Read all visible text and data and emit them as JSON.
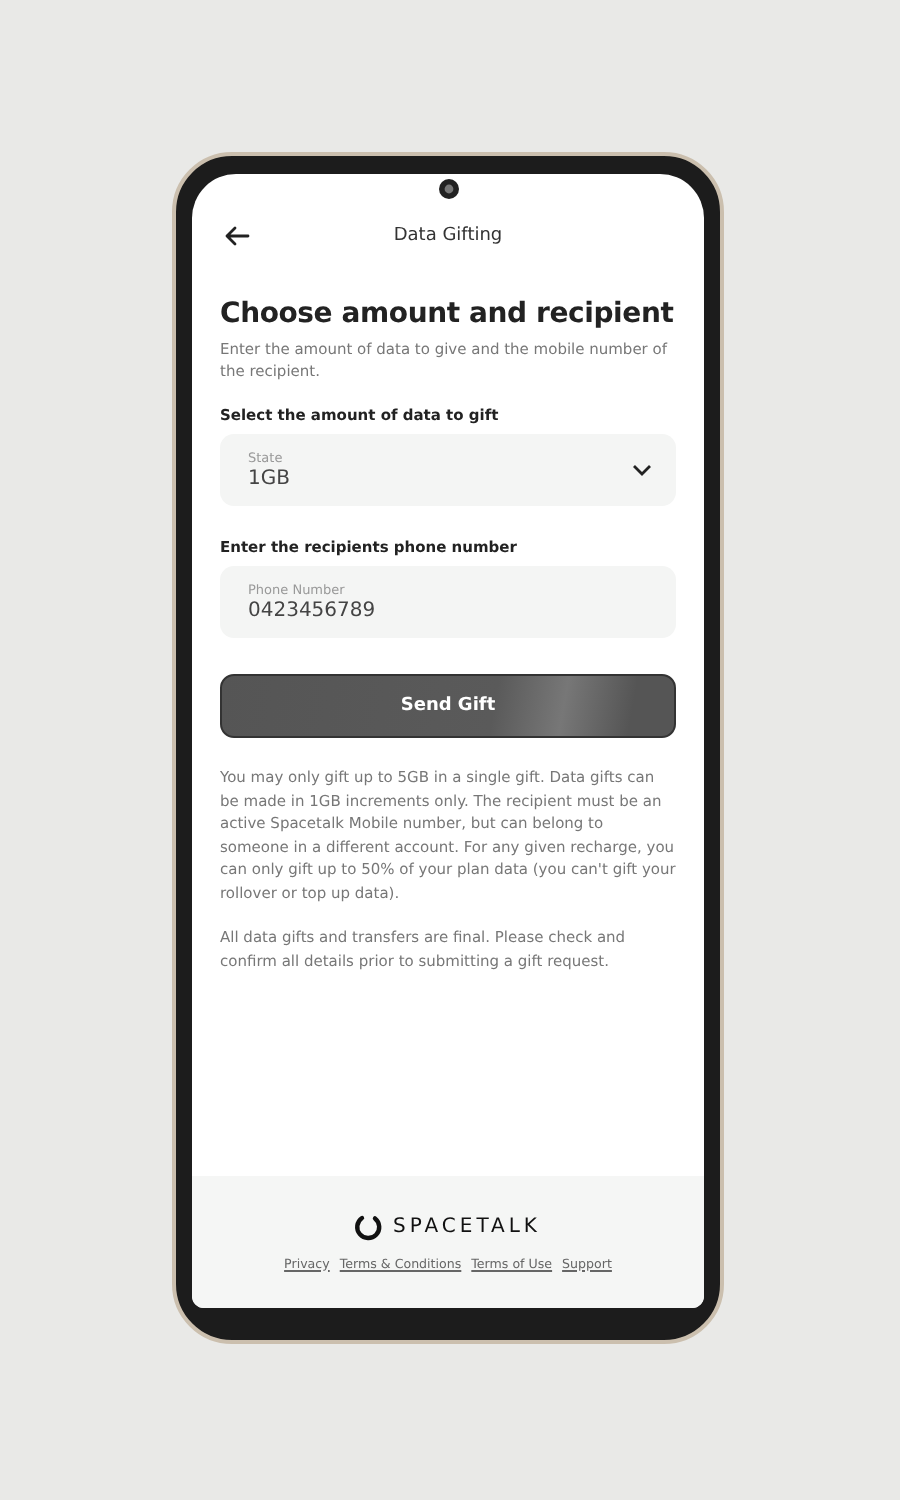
{
  "header": {
    "title": "Data Gifting"
  },
  "heading": "Choose amount and recipient",
  "intro": "Enter the amount of data to give and the mobile number of the recipient.",
  "amount": {
    "label": "Select the amount of data to gift",
    "field_label": "State",
    "value": "1GB"
  },
  "phone": {
    "label": "Enter the recipients phone number",
    "field_label": "Phone Number",
    "value": "0423456789"
  },
  "button": "Send Gift",
  "notes": [
    "You may only gift up to 5GB in a single gift. Data gifts can be made in 1GB increments only. The recipient must be an active Spacetalk Mobile number, but can belong to someone in a different account. For any given recharge, you can only gift up to 50% of your plan data (you can't gift your rollover or top up data).",
    "All data gifts and transfers are final. Please check and confirm all details prior to submitting a gift request."
  ],
  "footer": {
    "brand": "SPACETALK",
    "links": [
      "Privacy",
      "Terms & Conditions",
      "Terms of Use",
      "Support"
    ]
  }
}
